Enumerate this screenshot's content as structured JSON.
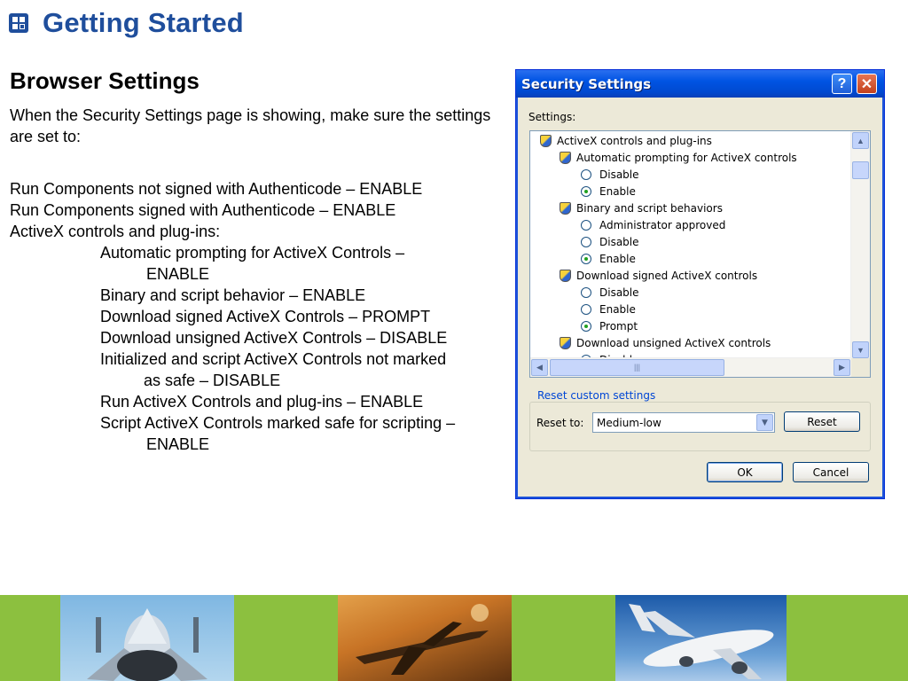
{
  "header": {
    "title": "Getting Started",
    "icon": "gear-box-icon"
  },
  "section": {
    "title": "Browser Settings",
    "intro": "When the Security Settings page is showing, make sure the settings are set to:"
  },
  "settings_lines": [
    "Run Components not signed with Authenticode – ENABLE",
    "Run Components signed with Authenticode – ENABLE",
    "ActiveX controls and plug-ins:",
    "Automatic prompting for ActiveX Controls –",
    "ENABLE",
    "Binary and script behavior – ENABLE",
    "Download signed ActiveX Controls – PROMPT",
    "Download unsigned ActiveX Controls – DISABLE",
    "Initialized and script ActiveX Controls not marked",
    "as safe – DISABLE",
    "Run ActiveX Controls and plug-ins – ENABLE",
    "Script ActiveX Controls marked safe for scripting –",
    "ENABLE"
  ],
  "dialog": {
    "title": "Security Settings",
    "help_glyph": "?",
    "close_glyph": "✕",
    "settings_label": "Settings:",
    "tree": [
      {
        "kind": "category",
        "label": "ActiveX controls and plug-ins"
      },
      {
        "kind": "setting",
        "label": "Automatic prompting for ActiveX controls"
      },
      {
        "kind": "option",
        "label": "Disable",
        "selected": false
      },
      {
        "kind": "option",
        "label": "Enable",
        "selected": true
      },
      {
        "kind": "setting",
        "label": "Binary and script behaviors"
      },
      {
        "kind": "option",
        "label": "Administrator approved",
        "selected": false
      },
      {
        "kind": "option",
        "label": "Disable",
        "selected": false
      },
      {
        "kind": "option",
        "label": "Enable",
        "selected": true
      },
      {
        "kind": "setting",
        "label": "Download signed ActiveX controls"
      },
      {
        "kind": "option",
        "label": "Disable",
        "selected": false
      },
      {
        "kind": "option",
        "label": "Enable",
        "selected": false
      },
      {
        "kind": "option",
        "label": "Prompt",
        "selected": true
      },
      {
        "kind": "setting",
        "label": "Download unsigned ActiveX controls"
      },
      {
        "kind": "option",
        "label": "Disable",
        "selected": true
      }
    ],
    "reset_group_label": "Reset custom settings",
    "reset_to_label": "Reset to:",
    "reset_to_value": "Medium-low",
    "reset_button": "Reset",
    "ok_button": "OK",
    "cancel_button": "Cancel",
    "scroll_glyphs": {
      "up": "▲",
      "down": "▼",
      "left": "◀",
      "right": "▶",
      "grip": "|||"
    }
  },
  "colors": {
    "header_blue": "#1f4e9c",
    "title_bar_blue": "#0054e3",
    "dialog_face": "#ece9d8",
    "footer_green": "#8cc03f"
  }
}
